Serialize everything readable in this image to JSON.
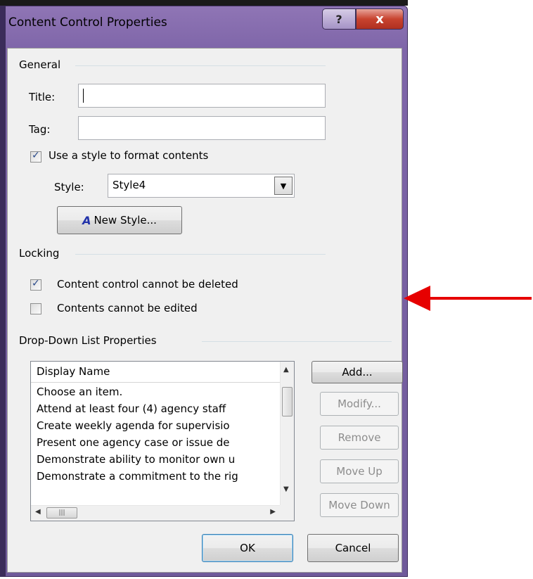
{
  "window": {
    "title": "Content Control Properties",
    "help_label": "?",
    "close_label": "x"
  },
  "general": {
    "section_label": "General",
    "title_label": "Title:",
    "title_value": "",
    "tag_label": "Tag:",
    "tag_value": "",
    "use_style_label": "Use a style to format contents",
    "use_style_checked": true,
    "style_label": "Style:",
    "style_value": "Style4",
    "new_style_label": "New Style..."
  },
  "locking": {
    "section_label": "Locking",
    "cannot_delete_label": "Content control cannot be deleted",
    "cannot_delete_checked": true,
    "cannot_edit_label": "Contents cannot be edited",
    "cannot_edit_checked": false
  },
  "dropdown": {
    "section_label": "Drop-Down List Properties",
    "column_header": "Display Name",
    "items": [
      "Choose an item.",
      "Attend at least four (4) agency staff",
      "Create weekly agenda for supervisio",
      "Present one agency case or issue de",
      "Demonstrate ability to monitor own u",
      "Demonstrate a commitment to the rig"
    ],
    "add_label": "Add...",
    "modify_label": "Modify...",
    "remove_label": "Remove",
    "move_up_label": "Move Up",
    "move_down_label": "Move Down"
  },
  "footer": {
    "ok_label": "OK",
    "cancel_label": "Cancel"
  },
  "icons": [
    "help-icon",
    "close-icon",
    "checkbox-checked-icon",
    "dropdown-arrow-icon",
    "new-style-icon",
    "scroll-up-icon",
    "scroll-down-icon",
    "scroll-left-icon",
    "scroll-right-icon",
    "red-arrow-annotation"
  ],
  "colors": {
    "titlebar": "#7f66a9",
    "close_button": "#c8432f",
    "dialog_body": "#f0f0f0",
    "annotation_arrow": "#e60000"
  }
}
